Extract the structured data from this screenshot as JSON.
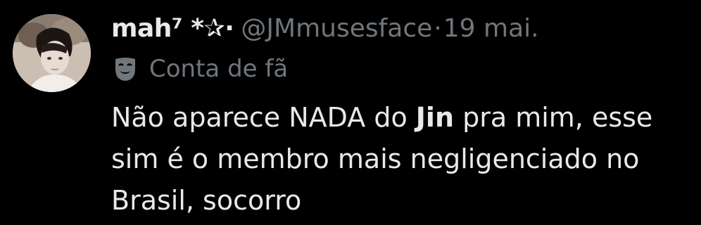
{
  "tweet": {
    "author": {
      "display_name": "mah⁷ *✰·",
      "handle": "@JMmusesface",
      "avatar_icon": "profile-avatar"
    },
    "separator": "·",
    "date": "19 mai.",
    "account_label": {
      "icon": "theater-mask-icon",
      "text": "Conta de fã"
    },
    "body": {
      "line1_pre": "Não aparece NADA do ",
      "line1_bold": "Jin",
      "line1_post": " pra mim, esse",
      "line2": "sim é o membro mais negligenciado no",
      "line3": "Brasil, socorro"
    }
  },
  "colors": {
    "background": "#000000",
    "primary_text": "#e7e9ea",
    "secondary_text": "#71767b"
  }
}
